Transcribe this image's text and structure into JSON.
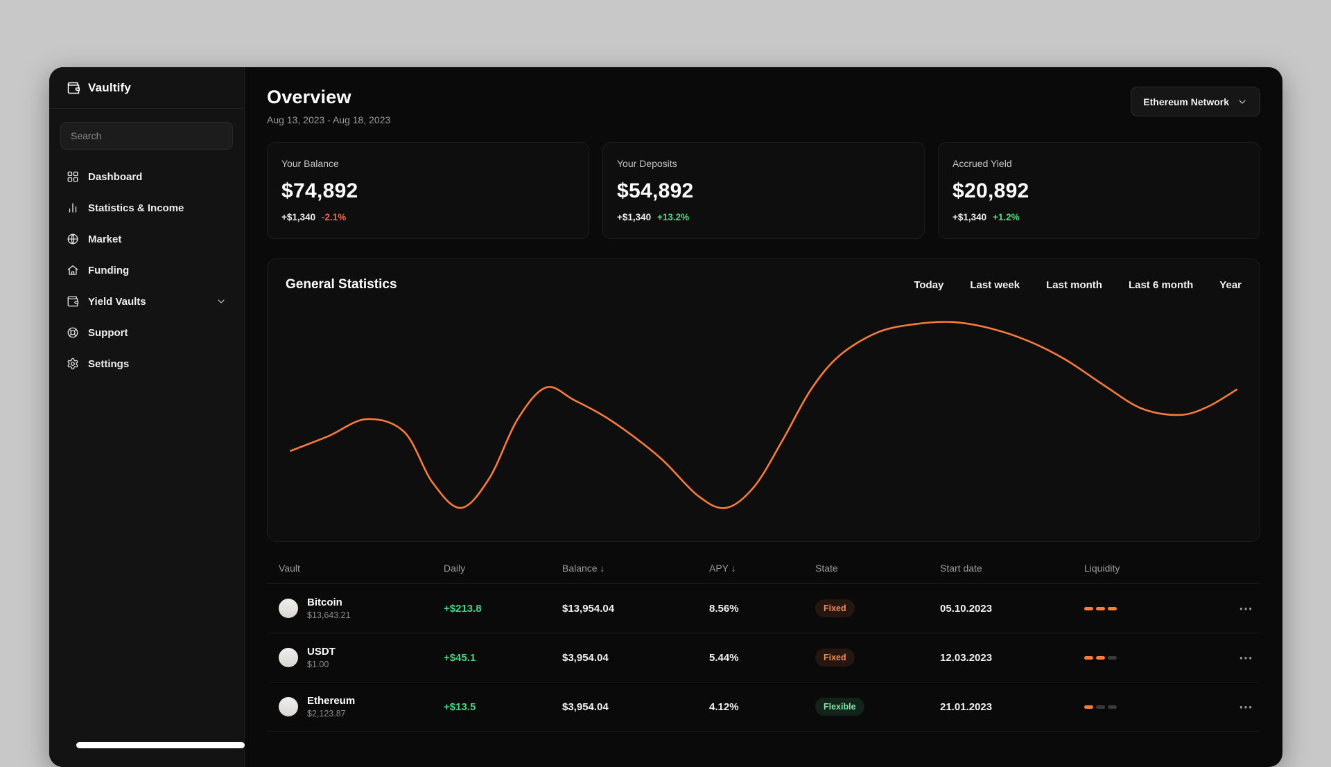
{
  "app": {
    "name": "Vaultify"
  },
  "sidebar": {
    "search_placeholder": "Search",
    "items": [
      {
        "label": "Dashboard",
        "icon": "dashboard-grid-icon"
      },
      {
        "label": "Statistics & Income",
        "icon": "bar-chart-icon"
      },
      {
        "label": "Market",
        "icon": "globe-icon"
      },
      {
        "label": "Funding",
        "icon": "home-icon"
      },
      {
        "label": "Yield Vaults",
        "icon": "vault-wallet-icon",
        "has_chevron": true
      },
      {
        "label": "Support",
        "icon": "support-icon"
      },
      {
        "label": "Settings",
        "icon": "gear-icon"
      }
    ]
  },
  "header": {
    "title": "Overview",
    "date_range": "Aug 13, 2023 - Aug 18, 2023",
    "network_selector": "Ethereum Network"
  },
  "stat_cards": [
    {
      "label": "Your Balance",
      "value": "$74,892",
      "delta_amount": "+$1,340",
      "delta_pct": "-2.1%",
      "delta_color": "#f2684a"
    },
    {
      "label": "Your Deposits",
      "value": "$54,892",
      "delta_amount": "+$1,340",
      "delta_pct": "+13.2%",
      "delta_color": "#4ade80"
    },
    {
      "label": "Accrued Yield",
      "value": "$20,892",
      "delta_amount": "+$1,340",
      "delta_pct": "+1.2%",
      "delta_color": "#4ade80"
    }
  ],
  "statistics": {
    "title": "General Statistics",
    "filters": [
      "Today",
      "Last week",
      "Last month",
      "Last 6 month",
      "Year"
    ]
  },
  "chart_data": {
    "type": "line",
    "title": "General Statistics",
    "xlabel": "",
    "ylabel": "",
    "axes_visible": false,
    "grid": false,
    "legend": false,
    "line_color": "#f97b3d",
    "x_unit": "percent-of-width",
    "y_unit": "relative-value-0-100",
    "points": [
      [
        0,
        33
      ],
      [
        4,
        40
      ],
      [
        8,
        48
      ],
      [
        12,
        42
      ],
      [
        15,
        18
      ],
      [
        18,
        6
      ],
      [
        21,
        20
      ],
      [
        24,
        48
      ],
      [
        27,
        63
      ],
      [
        30,
        57
      ],
      [
        34,
        47
      ],
      [
        39,
        30
      ],
      [
        43,
        12
      ],
      [
        46,
        6
      ],
      [
        49,
        16
      ],
      [
        52,
        38
      ],
      [
        55,
        62
      ],
      [
        58,
        78
      ],
      [
        62,
        89
      ],
      [
        66,
        93
      ],
      [
        70,
        94
      ],
      [
        74,
        91
      ],
      [
        78,
        85
      ],
      [
        82,
        76
      ],
      [
        86,
        64
      ],
      [
        90,
        53
      ],
      [
        94,
        50
      ],
      [
        97,
        54
      ],
      [
        100,
        62
      ]
    ]
  },
  "table": {
    "columns": [
      {
        "label": "Vault"
      },
      {
        "label": "Daily"
      },
      {
        "label": "Balance",
        "sort_arrow": "↓"
      },
      {
        "label": "APY",
        "sort_arrow": "↓"
      },
      {
        "label": "State"
      },
      {
        "label": "Start date"
      },
      {
        "label": "Liquidity"
      },
      {
        "label": ""
      }
    ],
    "rows": [
      {
        "vault": "Bitcoin",
        "price": "$13,643.21",
        "daily": "+$213.8",
        "balance": "$13,954.04",
        "apy": "8.56%",
        "state": "Fixed",
        "state_style": "fixed",
        "start_date": "05.10.2023",
        "liquidity": 3
      },
      {
        "vault": "USDT",
        "price": "$1.00",
        "daily": "+$45.1",
        "balance": "$3,954.04",
        "apy": "5.44%",
        "state": "Fixed",
        "state_style": "fixed",
        "start_date": "12.03.2023",
        "liquidity": 2
      },
      {
        "vault": "Ethereum",
        "price": "$2,123.87",
        "daily": "+$13.5",
        "balance": "$3,954.04",
        "apy": "4.12%",
        "state": "Flexible",
        "state_style": "flexible",
        "start_date": "21.01.2023",
        "liquidity": 1
      }
    ],
    "liquidity_max": 3
  },
  "icons": {
    "row_menu_glyph": "⋯",
    "logo": "wallet-icon",
    "network_chevron": "chevron-down-icon"
  },
  "colors": {
    "page_background": "#c8c8c8",
    "app_background": "#0a0a0a",
    "sidebar_background": "#131313",
    "card_background": "#0e0e0e",
    "accent_orange": "#f97c3e",
    "positive_green": "#4ade80",
    "negative_red": "#f2684a",
    "muted_text": "#9b9b9b"
  }
}
